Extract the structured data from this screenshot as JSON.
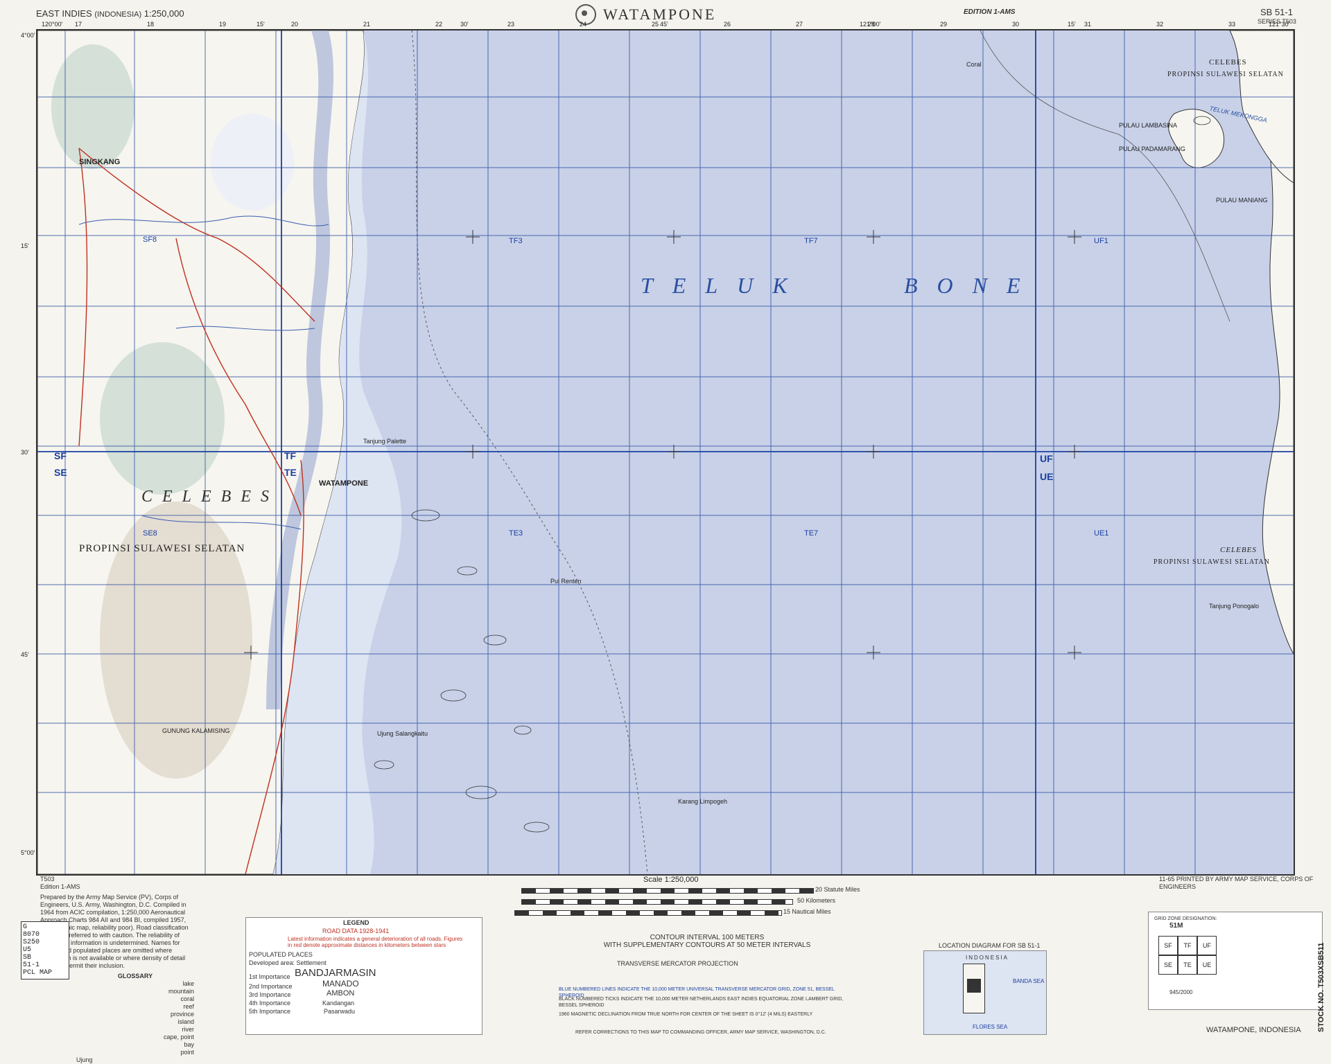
{
  "header": {
    "series_left": "EAST INDIES",
    "country": "(INDONESIA)",
    "scale": "1:250,000",
    "title": "WATAMPONE",
    "edition": "EDITION 1-AMS",
    "sheet": "SB 51-1",
    "series": "SERIES T503"
  },
  "map": {
    "sea_label_1": "TELUK",
    "sea_label_2": "BONE",
    "land_label": "CELEBES",
    "province_left": "PROPINSI SULAWESI SELATAN",
    "province_right_top": "PROPINSI SULAWESI SELATAN",
    "province_right_mid": "PROPINSI SULAWESI SELATAN",
    "celebes_top_right": "CELEBES",
    "celebes_mid_right": "CELEBES",
    "teluk_mekongga": "TELUK MEKONGGA",
    "places": {
      "singkang": "SINGKANG",
      "watampone": "WATAMPONE",
      "pulau_lambasina": "PULAU LAMBASINA",
      "pulau_padamarang": "PULAU PADAMARANG",
      "pulau_maniang": "PULAU MANIANG",
      "tanjung_palette": "Tanjung Palette",
      "karang_limpogeh": "Karang Limpogeh",
      "tanjung_ponogalo": "Tanjung Ponogalo",
      "gunung_kalamising": "GUNUNG KALAMISING",
      "ujung_salangkaitu": "Ujung Salangkaitu",
      "pulau_renten": "Pul Renten",
      "coral": "Coral"
    },
    "zones": {
      "sf": "SF",
      "se": "SE",
      "tf": "TF",
      "te": "TE",
      "uf": "UF",
      "ue": "UE",
      "sf8": "SF8",
      "se8": "SE8",
      "tf3": "TF3",
      "tf7": "TF7",
      "te3": "TE3",
      "te7": "TE7",
      "uf1": "UF1",
      "ue1": "UE1"
    },
    "lat_labels": [
      "4°00'",
      "15'",
      "30'",
      "45'",
      "5°00'"
    ],
    "lon_labels": [
      "120°00'",
      "15'",
      "30'",
      "45'",
      "121°00'",
      "15'",
      "121°30'"
    ],
    "grid_numbers": [
      "17",
      "18",
      "19",
      "20",
      "21",
      "22",
      "23",
      "24",
      "25",
      "26",
      "27",
      "28",
      "29",
      "30",
      "31",
      "32",
      "33"
    ]
  },
  "footer": {
    "series_code": "T503",
    "edition": "Edition 1-AMS",
    "prepared_text": "Prepared by the Army Map Service (PV), Corps of Engineers, U.S. Army, Washington, D.C. Compiled in 1964 from ACIC compilation, 1:250,000 Aeronautical Approach Charts 984 AII and 984 BI, compiled 1957, (topographic map, reliability poor). Road classification should be referred to with caution. The reliability of vegetation information is undetermined. Names for symbolized populated places are omitted where information is not available or where density of detail does not permit their inclusion.",
    "scale_title": "Scale 1:250,000",
    "statute_miles": "20 Statute Miles",
    "kilometers": "50 Kilometers",
    "nautical_miles": "15 Nautical Miles",
    "printed_by": "11-65    PRINTED BY ARMY MAP SERVICE, CORPS OF ENGINEERS",
    "legend_title": "LEGEND",
    "road_data": "ROAD DATA 1928-1941",
    "road_note": "Latest information indicates a general deterioration of all roads. Figures in red denote approximate distances in kilometers between stars",
    "populated_places": "POPULATED PLACES",
    "developed_area": "Developed area: Settlement",
    "town_1": "BANDJARMASIN",
    "town_2": "MANADO",
    "town_3": "AMBON",
    "town_4": "Kandangan",
    "town_5": "Pasarwadu",
    "importance": [
      "1st Importance",
      "2nd Importance",
      "3rd Importance",
      "4th Importance",
      "5th Importance"
    ],
    "contour": "CONTOUR INTERVAL 100 METERS",
    "contour_sub": "WITH SUPPLEMENTARY CONTOURS AT 50 METER INTERVALS",
    "projection": "TRANSVERSE MERCATOR PROJECTION",
    "utm_note": "BLUE NUMBERED LINES INDICATE THE 10,000 METER UNIVERSAL TRANSVERSE MERCATOR GRID, ZONE 51, BESSEL SPHEROID",
    "black_note": "BLACK NUMBERED TICKS INDICATE THE 10,000 METER NETHERLANDS EAST INDIES EQUATORIAL ZONE LAMBERT GRID, BESSEL SPHEROID",
    "declination": "1960 MAGNETIC DECLINATION FROM TRUE NORTH FOR CENTER OF THE SHEET IS 0°12' (4 MILS) EASTERLY",
    "refer": "REFER CORRECTIONS TO THIS MAP TO COMMANDING OFFICER, ARMY MAP SERVICE, WASHINGTON, D.C.",
    "location_diagram": "LOCATION DIAGRAM FOR SB 51-1",
    "indonesia": "INDONESIA",
    "banda_sea": "BANDA SEA",
    "flores_sea": "FLORES SEA",
    "glossary": "GLOSSARY",
    "glossary_terms": [
      "lake",
      "mountain",
      "coral",
      "reef",
      "province",
      "island",
      "river",
      "cape, point",
      "bay",
      "point"
    ],
    "glossary_ujung": "Ujung",
    "sheet_name": "WATAMPONE, INDONESIA",
    "stock_no": "STOCK NO. T503XSB511",
    "stamp": [
      "G",
      "8070",
      "S250",
      "U5",
      "SB",
      "51-1",
      "PCL MAP"
    ],
    "grid_designation": "GRID ZONE DESIGNATION:",
    "grid_zone": "51M",
    "grid_squares": [
      "SF",
      "TF",
      "UF",
      "SE",
      "TE",
      "UE"
    ],
    "sample_ref": "945/2000"
  },
  "colors": {
    "sea": "#c8d1e8",
    "land": "#f6f5ef",
    "grid_blue": "#2a4fa0",
    "contour": "#b89f88",
    "road_red": "#c03020",
    "vegetation": "#d4e0d8"
  }
}
